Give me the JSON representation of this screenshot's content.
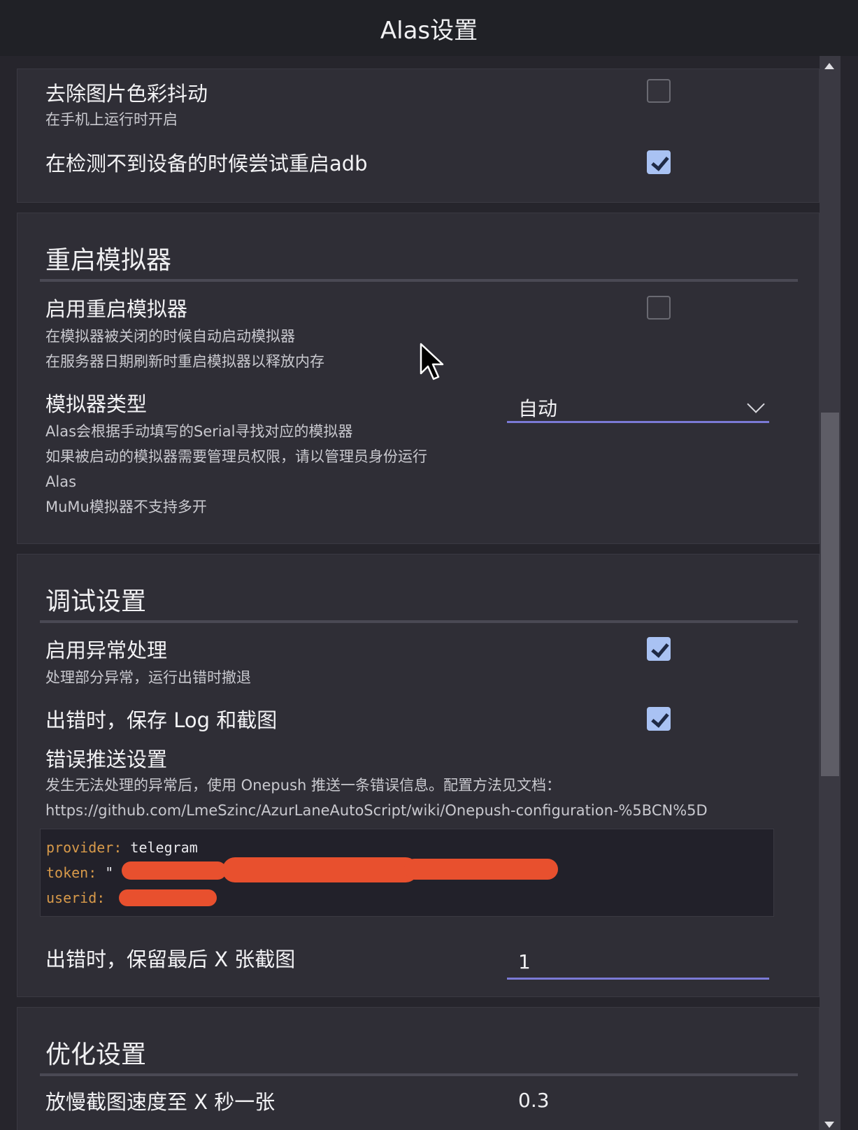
{
  "window": {
    "title": "Alas设置"
  },
  "sections": {
    "device": {
      "options": [
        {
          "title": "去除图片色彩抖动",
          "desc": "在手机上运行时开启",
          "checked": false
        },
        {
          "title": "在检测不到设备的时候尝试重启adb",
          "checked": true
        }
      ]
    },
    "restart_emulator": {
      "title": "重启模拟器",
      "enable": {
        "title": "启用重启模拟器",
        "desc1": "在模拟器被关闭的时候自动启动模拟器",
        "desc2": "在服务器日期刷新时重启模拟器以释放内存",
        "checked": false
      },
      "emulator_type": {
        "title": "模拟器类型",
        "desc1": "Alas会根据手动填写的Serial寻找对应的模拟器",
        "desc2": "如果被启动的模拟器需要管理员权限，请以管理员身份运行",
        "desc3": "Alas",
        "desc4": "MuMu模拟器不支持多开",
        "selected": "自动"
      }
    },
    "debug": {
      "title": "调试设置",
      "exception": {
        "title": "启用异常处理",
        "desc": "处理部分异常，运行出错时撤退",
        "checked": true
      },
      "save_log": {
        "title": "出错时，保存 Log 和截图",
        "checked": true
      },
      "push": {
        "title": "错误推送设置",
        "desc1": "发生无法处理的异常后，使用 Onepush 推送一条错误信息。配置方法见文档：",
        "desc2": "https://github.com/LmeSzinc/AzurLaneAutoScript/wiki/Onepush-configuration-%5BCN%5D",
        "code": {
          "provider_key": "provider:",
          "provider_val": " telegram",
          "token_key": "token:",
          "token_val": " \"",
          "userid_key": "userid:",
          "userid_val": " "
        }
      },
      "keep_screenshots": {
        "title": "出错时，保留最后 X 张截图",
        "value": "1"
      }
    },
    "optimization": {
      "title": "优化设置",
      "screenshot_interval": {
        "title": "放慢截图速度至 X 秒一张",
        "value": "0.3"
      }
    }
  },
  "colors": {
    "accent": "#7b7ad6",
    "checkbox_on": "#a9c2f3",
    "redaction": "#e8502e"
  }
}
